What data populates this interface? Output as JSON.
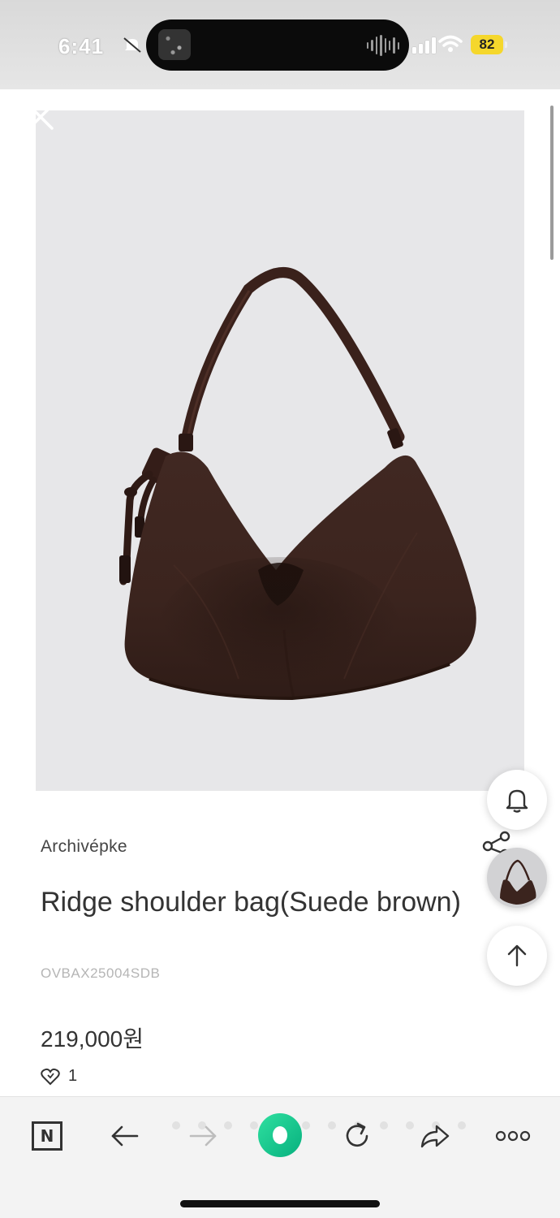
{
  "status_bar": {
    "time": "6:41",
    "battery": "82"
  },
  "product": {
    "brand": "Archivépke",
    "title": "Ridge shoulder bag(Suede brown)",
    "sku": "OVBAX25004SDB",
    "price": "219,000원",
    "likes": "1"
  },
  "icons": {
    "close": "close-icon",
    "bell": "bell-icon",
    "share": "share-icon",
    "scroll_top": "arrow-up-icon",
    "back": "arrow-left-icon",
    "forward": "arrow-right-icon",
    "refresh": "refresh-icon",
    "send": "share-arrow-icon",
    "more": "more-icon",
    "naver": "N"
  },
  "colors": {
    "bag": "#3e2620",
    "accent_green": "#10c78a",
    "battery": "#f5d72c"
  }
}
